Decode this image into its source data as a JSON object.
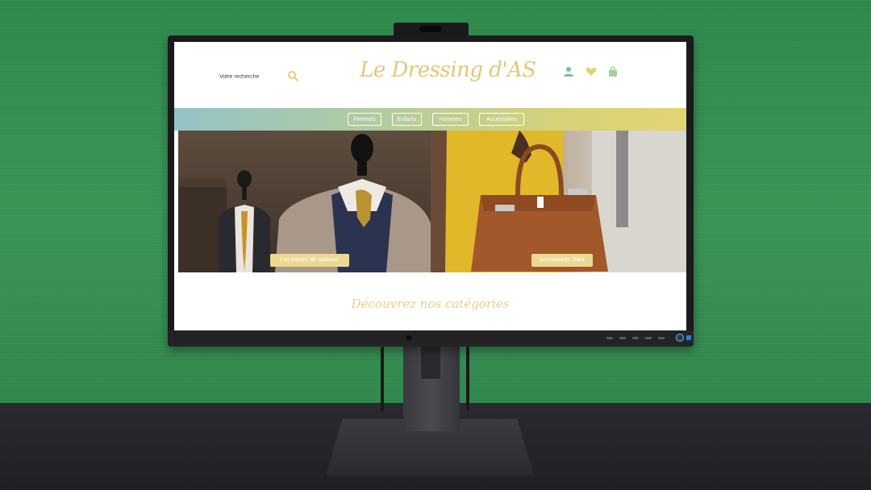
{
  "site": {
    "logo_text": "Le Dressing d'AS",
    "search": {
      "placeholder": "Votre recherche"
    },
    "header_icons": [
      "user-icon",
      "heart-icon",
      "shopping-bag-icon"
    ],
    "nav": {
      "items": [
        {
          "label": "Femmes"
        },
        {
          "label": "Enfants"
        },
        {
          "label": "Hommes"
        },
        {
          "label": "Accessoires"
        }
      ]
    },
    "hero": {
      "left_button": "Les tenues de costume",
      "right_button": "Accessoires chics"
    },
    "categories_title": "Découvrez nos catégories"
  },
  "colors": {
    "gold_accent": "#e1c877",
    "teal_icon": "#7fb8b5",
    "nav_gradient_start": "#93c3c7",
    "nav_gradient_end": "#e2d472",
    "button_fill": "#ecd893",
    "background_wall": "#3a9657"
  }
}
